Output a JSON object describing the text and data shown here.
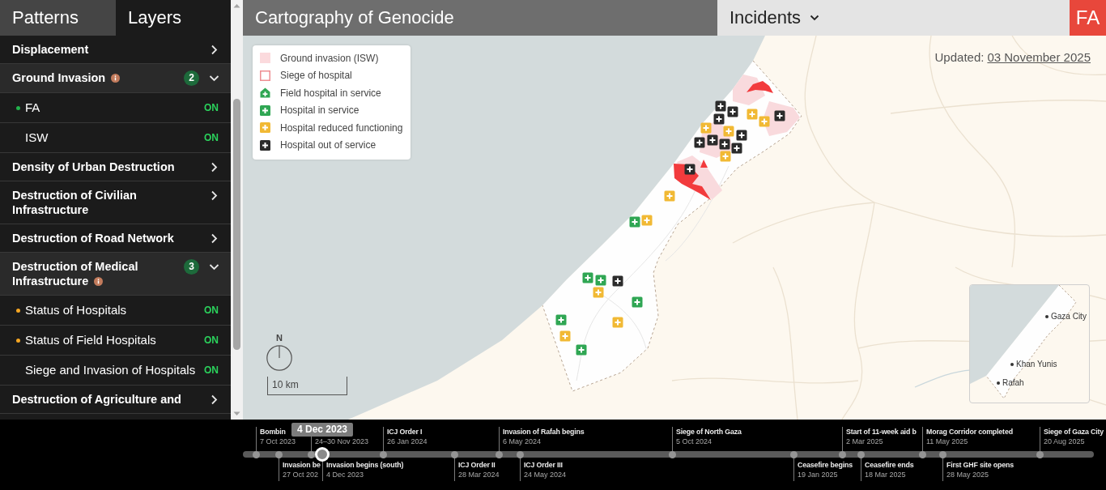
{
  "sidebar": {
    "tabs": [
      {
        "label": "Patterns",
        "selected": true
      },
      {
        "label": "Layers",
        "selected": false
      }
    ],
    "items": [
      {
        "label": "Displacement",
        "expanded": false
      },
      {
        "label": "Ground Invasion",
        "info": true,
        "count": "2",
        "expanded": true,
        "children": [
          {
            "label": "FA",
            "color": "#22b24c",
            "toggle": "ON"
          },
          {
            "label": "ISW",
            "toggle": "ON"
          }
        ]
      },
      {
        "label": "Density of Urban Destruction",
        "expanded": false
      },
      {
        "label": "Destruction of Civilian Infrastructure",
        "expanded": false
      },
      {
        "label": "Destruction of Road Network",
        "expanded": false
      },
      {
        "label": "Destruction of Medical Infrastructure",
        "info": true,
        "count": "3",
        "expanded": true,
        "children": [
          {
            "label": "Status of Hospitals",
            "color": "#f5a623",
            "toggle": "ON"
          },
          {
            "label": "Status of Field Hospitals",
            "color": "#f5a623",
            "toggle": "ON"
          },
          {
            "label": "Siege and Invasion of Hospitals",
            "toggle": "ON"
          }
        ]
      },
      {
        "label": "Destruction of Agriculture and",
        "expanded": false
      }
    ]
  },
  "header": {
    "title": "Cartography of Genocide",
    "dropdown": "Incidents",
    "logo": "FA"
  },
  "map": {
    "legend": [
      {
        "kind": "fill",
        "color": "#fbdadd",
        "label": "Ground invasion (ISW)"
      },
      {
        "kind": "outline",
        "color": "#ee8e92",
        "label": "Siege of hospital"
      },
      {
        "kind": "house",
        "color": "#2fa653",
        "label": "Field hospital in service"
      },
      {
        "kind": "plus",
        "color": "#2fa653",
        "label": "Hospital in service"
      },
      {
        "kind": "plus",
        "color": "#f1b934",
        "label": "Hospital reduced functioning"
      },
      {
        "kind": "plus",
        "color": "#2b2b2b",
        "label": "Hospital out of service"
      }
    ],
    "updated": {
      "label": "Updated:",
      "date": "03 November 2025"
    },
    "markers": [
      {
        "kind": "closed"
      },
      {
        "kind": "closed"
      },
      {
        "kind": "reduced"
      },
      {
        "kind": "closed"
      },
      {
        "kind": "reduced"
      },
      {
        "kind": "closed"
      },
      {
        "kind": "reduced"
      },
      {
        "kind": "closed"
      },
      {
        "kind": "reduced"
      },
      {
        "kind": "closed"
      },
      {
        "kind": "closed"
      },
      {
        "kind": "closed"
      },
      {
        "kind": "closed"
      },
      {
        "kind": "reduced"
      },
      {
        "kind": "closed"
      },
      {
        "kind": "reduced"
      },
      {
        "kind": "reduced"
      },
      {
        "kind": "operating"
      },
      {
        "kind": "operating"
      },
      {
        "kind": "operating"
      },
      {
        "kind": "closed"
      },
      {
        "kind": "reduced"
      },
      {
        "kind": "operating"
      },
      {
        "kind": "operating"
      },
      {
        "kind": "reduced"
      },
      {
        "kind": "reduced"
      },
      {
        "kind": "operating"
      }
    ],
    "north_label": "N",
    "scale_label": "10 km",
    "inset": {
      "places": [
        "Gaza City",
        "Khan Yunis",
        "Rafah"
      ]
    }
  },
  "timeline": {
    "tooltip": "4 Dec 2023",
    "events": [
      {
        "title": "Bombin",
        "date": "7 Oct 2023",
        "selected": false
      },
      {
        "title": "Invasion be",
        "date": "27 Oct 202",
        "selected": false
      },
      {
        "date": "24–30 Nov 2023",
        "selected": false
      },
      {
        "title": "Invasion begins (south)",
        "date": "4 Dec 2023",
        "selected": true
      },
      {
        "title": "ICJ Order I",
        "date": "26 Jan 2024",
        "selected": false
      },
      {
        "title": "ICJ Order II",
        "date": "28 Mar 2024",
        "selected": false
      },
      {
        "title": "Invasion of Rafah begins",
        "date": "6 May 2024",
        "selected": false
      },
      {
        "title": "ICJ Order III",
        "date": "24 May 2024",
        "selected": false
      },
      {
        "title": "Siege of North Gaza",
        "date": "5 Oct 2024",
        "selected": false
      },
      {
        "title": "Ceasefire begins",
        "date": "19 Jan 2025",
        "selected": false
      },
      {
        "title": "Start of 11-week aid b",
        "date": "2 Mar 2025",
        "selected": false
      },
      {
        "title": "Ceasefire ends",
        "date": "18 Mar 2025",
        "selected": false
      },
      {
        "title": "Morag Corridor completed",
        "date": "11 May 2025",
        "selected": false
      },
      {
        "title": "First GHF site opens",
        "date": "28 May 2025",
        "selected": false
      },
      {
        "title": "Siege of Gaza City",
        "date": "20 Aug 2025",
        "selected": false
      }
    ]
  }
}
